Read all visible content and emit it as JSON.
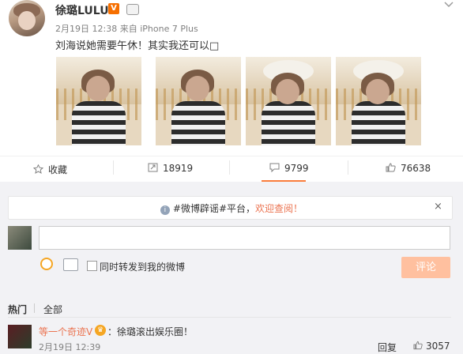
{
  "post": {
    "author": "徐璐LULU",
    "verified_badge": "V",
    "date": "2月19日 12:38",
    "via_prefix": "来自",
    "via_device": "iPhone 7 Plus",
    "text": "刘海说她需要午休！其实我还可以□",
    "photos_count": 4
  },
  "actions": {
    "favorite_label": "收藏",
    "repost_count": "18919",
    "comment_count": "9799",
    "like_count": "76638"
  },
  "notice": {
    "prefix": "#微博辟谣#平台，",
    "highlight": "欢迎查阅！",
    "close": "×"
  },
  "composer": {
    "checkbox_label": "同时转发到我的微博",
    "submit_label": "评论"
  },
  "comment_tabs": {
    "hot": "热门",
    "all": "全部"
  },
  "comment": {
    "user": "等一个奇迹V",
    "text": "：徐璐滚出娱乐圈！",
    "time": "2月19日 12:39",
    "reply_label": "回复",
    "likes": "3057"
  },
  "colors": {
    "accent": "#eb7350",
    "tab_underline": "#fa7d3c",
    "submit_bg": "#ffc09f",
    "panel_bg": "#f2f2f5"
  },
  "icons": [
    "star-icon",
    "repost-icon",
    "comment-icon",
    "thumbs-up-icon",
    "info-icon",
    "emoji-icon",
    "image-icon",
    "chevron-down-icon"
  ]
}
